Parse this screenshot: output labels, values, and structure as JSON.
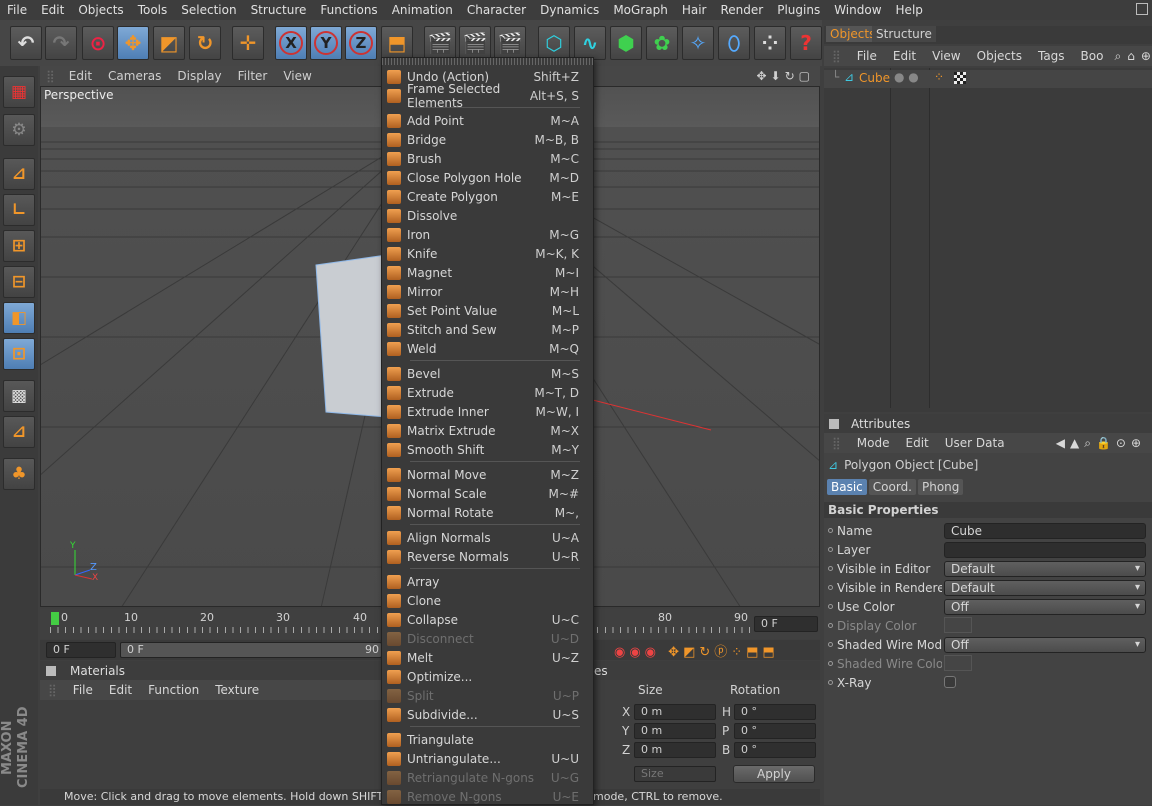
{
  "menubar": [
    "File",
    "Edit",
    "Objects",
    "Tools",
    "Selection",
    "Structure",
    "Functions",
    "Animation",
    "Character",
    "Dynamics",
    "MoGraph",
    "Hair",
    "Render",
    "Plugins",
    "Window",
    "Help"
  ],
  "viewport": {
    "menu": [
      "Edit",
      "Cameras",
      "Display",
      "Filter",
      "View"
    ],
    "label": "Perspective",
    "axes": {
      "y": "Y",
      "z": "Z",
      "x": "X"
    }
  },
  "toolbar": {
    "x": "X",
    "y": "Y",
    "z": "Z",
    "help": "?"
  },
  "timeline": {
    "ticks": [
      "0",
      "10",
      "20",
      "30",
      "40",
      "80",
      "90"
    ],
    "frame_left": "0 F",
    "frame_right": "0 F",
    "frame2": "0 F",
    "frame2_end": "90"
  },
  "dropdown": [
    {
      "label": "Undo (Action)",
      "sc": "Shift+Z"
    },
    {
      "label": "Frame Selected Elements",
      "sc": "Alt+S, S"
    },
    {
      "sep": true
    },
    {
      "label": "Add Point",
      "sc": "M~A"
    },
    {
      "label": "Bridge",
      "sc": "M~B, B"
    },
    {
      "label": "Brush",
      "sc": "M~C"
    },
    {
      "label": "Close Polygon Hole",
      "sc": "M~D"
    },
    {
      "label": "Create Polygon",
      "sc": "M~E"
    },
    {
      "label": "Dissolve",
      "sc": ""
    },
    {
      "label": "Iron",
      "sc": "M~G"
    },
    {
      "label": "Knife",
      "sc": "M~K, K"
    },
    {
      "label": "Magnet",
      "sc": "M~I"
    },
    {
      "label": "Mirror",
      "sc": "M~H"
    },
    {
      "label": "Set Point Value",
      "sc": "M~L"
    },
    {
      "label": "Stitch and Sew",
      "sc": "M~P"
    },
    {
      "label": "Weld",
      "sc": "M~Q"
    },
    {
      "sep": true
    },
    {
      "label": "Bevel",
      "sc": "M~S"
    },
    {
      "label": "Extrude",
      "sc": "M~T, D"
    },
    {
      "label": "Extrude Inner",
      "sc": "M~W, I"
    },
    {
      "label": "Matrix Extrude",
      "sc": "M~X"
    },
    {
      "label": "Smooth Shift",
      "sc": "M~Y"
    },
    {
      "sep": true
    },
    {
      "label": "Normal Move",
      "sc": "M~Z"
    },
    {
      "label": "Normal Scale",
      "sc": "M~#"
    },
    {
      "label": "Normal Rotate",
      "sc": "M~,"
    },
    {
      "sep": true
    },
    {
      "label": "Align Normals",
      "sc": "U~A"
    },
    {
      "label": "Reverse Normals",
      "sc": "U~R"
    },
    {
      "sep": true
    },
    {
      "label": "Array",
      "sc": ""
    },
    {
      "label": "Clone",
      "sc": ""
    },
    {
      "label": "Collapse",
      "sc": "U~C"
    },
    {
      "label": "Disconnect",
      "sc": "U~D",
      "dis": true
    },
    {
      "label": "Melt",
      "sc": "U~Z"
    },
    {
      "label": "Optimize...",
      "sc": ""
    },
    {
      "label": "Split",
      "sc": "U~P",
      "dis": true
    },
    {
      "label": "Subdivide...",
      "sc": "U~S"
    },
    {
      "sep": true
    },
    {
      "label": "Triangulate",
      "sc": ""
    },
    {
      "label": "Untriangulate...",
      "sc": "U~U"
    },
    {
      "label": "Retriangulate N-gons",
      "sc": "U~G",
      "dis": true
    },
    {
      "label": "Remove N-gons",
      "sc": "U~E",
      "dis": true
    }
  ],
  "objects": {
    "tabs": [
      "Objects",
      "Structure"
    ],
    "menu": [
      "File",
      "Edit",
      "View",
      "Objects",
      "Tags",
      "Boo"
    ],
    "item": "Cube"
  },
  "attributes": {
    "title": "Attributes",
    "menu": [
      "Mode",
      "Edit",
      "User Data"
    ],
    "object": "Polygon Object [Cube]",
    "tabs": [
      "Basic",
      "Coord.",
      "Phong"
    ],
    "section": "Basic Properties",
    "rows": [
      {
        "label": "Name",
        "value": "Cube",
        "type": "text"
      },
      {
        "label": "Layer",
        "value": "",
        "type": "text"
      },
      {
        "label": "Visible in Editor",
        "value": "Default",
        "type": "dd"
      },
      {
        "label": "Visible in Renderer",
        "value": "Default",
        "type": "dd"
      },
      {
        "label": "Use Color",
        "value": "Off",
        "type": "dd"
      },
      {
        "label": "Display Color",
        "value": "",
        "type": "color",
        "dim": true
      },
      {
        "label": "Shaded Wire Mode",
        "value": "Off",
        "type": "dd"
      },
      {
        "label": "Shaded Wire Color",
        "value": "",
        "type": "color",
        "dim": true
      },
      {
        "label": "X-Ray",
        "value": "",
        "type": "check"
      }
    ]
  },
  "materials": {
    "title": "Materials",
    "menu": [
      "File",
      "Edit",
      "Function",
      "Texture"
    ]
  },
  "coords": {
    "headers": [
      "Size",
      "Rotation"
    ],
    "suffix": "es",
    "rows": [
      {
        "axis": "X",
        "size": "0 m",
        "rot_axis": "H",
        "rot": "0 °"
      },
      {
        "axis": "Y",
        "size": "0 m",
        "rot_axis": "P",
        "rot": "0 °"
      },
      {
        "axis": "Z",
        "size": "0 m",
        "rot_axis": "B",
        "rot": "0 °"
      }
    ],
    "size_dd": "Size",
    "apply": "Apply"
  },
  "status": {
    "left": "Move: Click and drag to move elements. Hold down SHIFT to quar",
    "right": "mode, CTRL to remove."
  },
  "brand": "MAXON CINEMA 4D"
}
